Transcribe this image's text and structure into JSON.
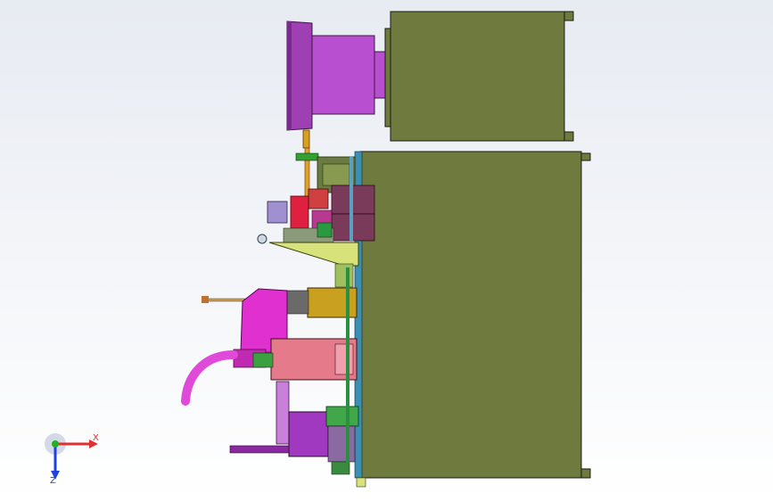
{
  "view": {
    "triad": {
      "x_label": "X",
      "z_label": "Z",
      "x_color": "#e03030",
      "y_color": "#20b020",
      "z_color": "#2040e0"
    },
    "colors": {
      "background_top": "#e7ebf2",
      "background_bottom": "#ffffff",
      "cabinet": "#6f7a3f",
      "purple": "#b04cc8",
      "magenta": "#e030d0",
      "pink": "#e57a8a",
      "gold": "#c9a020",
      "yellow_green": "#d8e27a"
    }
  }
}
